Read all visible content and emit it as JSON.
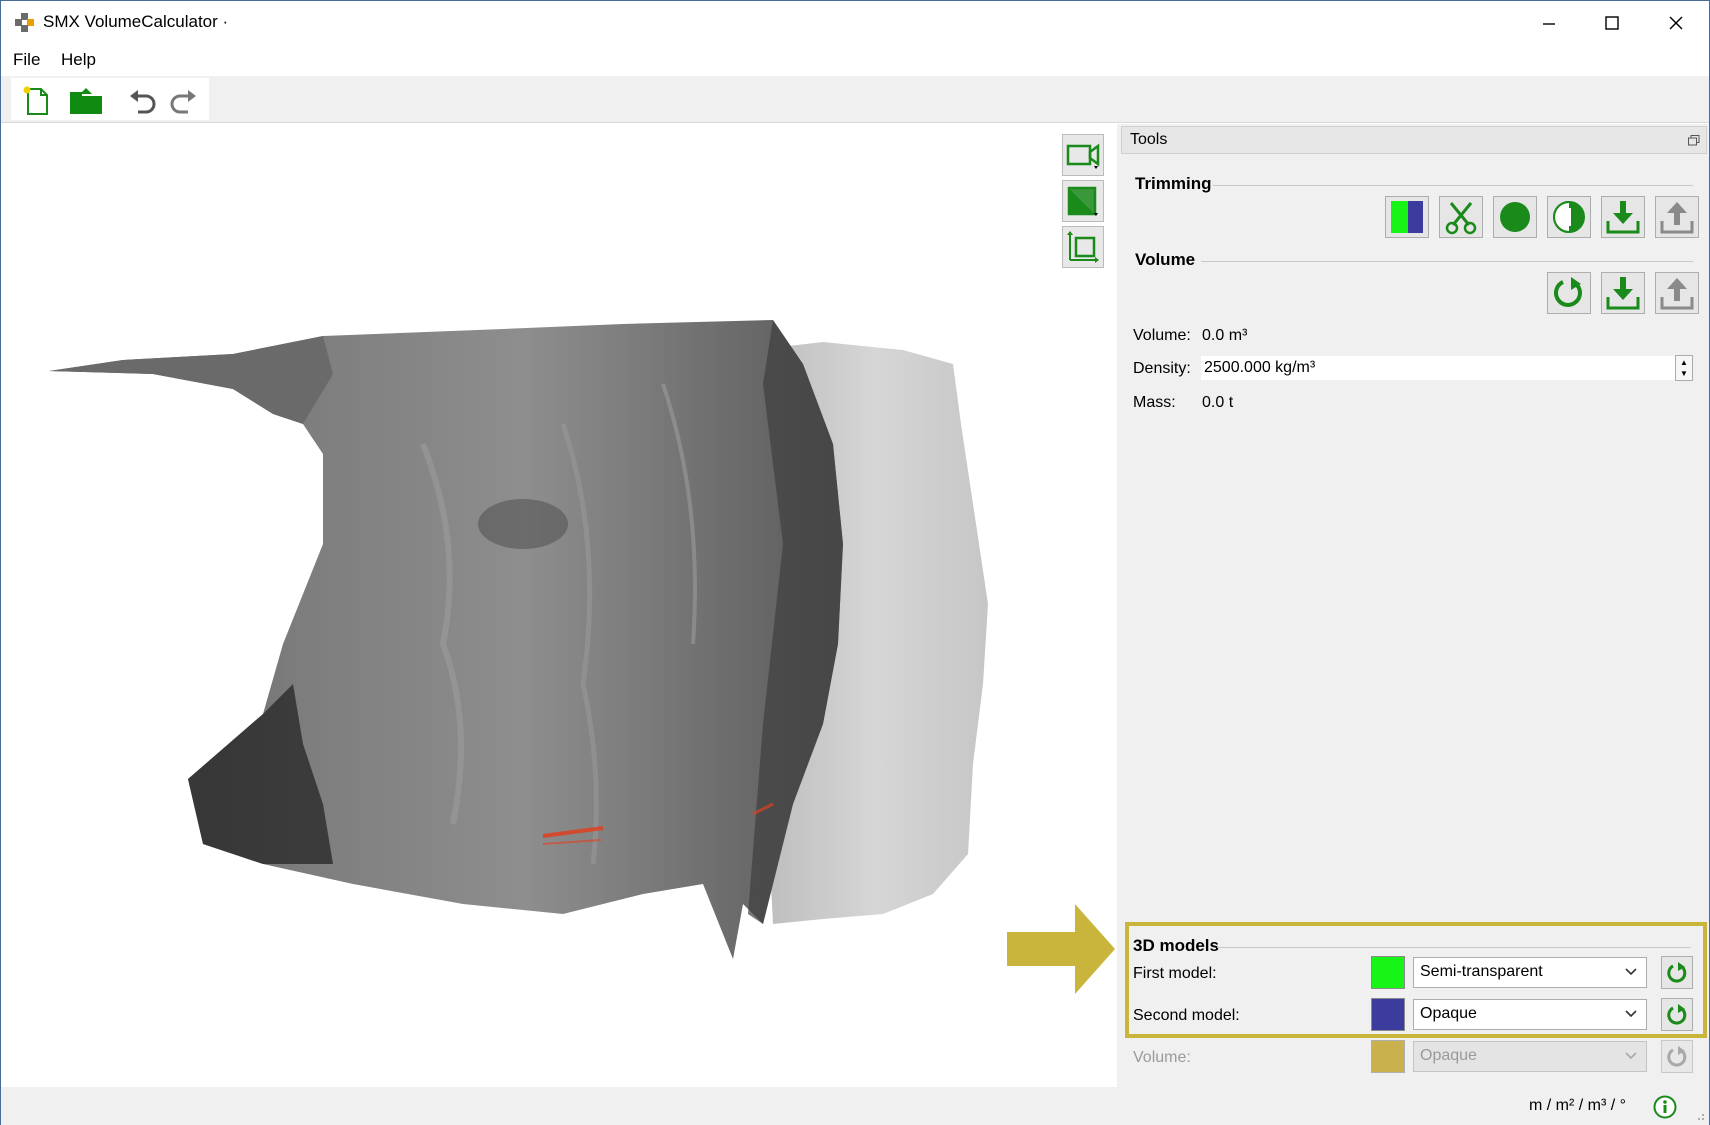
{
  "window": {
    "title": "SMX VolumeCalculator ·"
  },
  "menu": {
    "items": [
      "File",
      "Help"
    ]
  },
  "toolbar": {
    "buttons": [
      "new-document-icon",
      "open-folder-icon",
      "undo-icon",
      "redo-icon"
    ]
  },
  "viewport": {
    "buttons": [
      "camera-icon",
      "view-mode-icon",
      "bounding-box-icon"
    ]
  },
  "tools": {
    "title": "Tools",
    "trimming": {
      "title": "Trimming",
      "buttons": [
        "split-color-icon",
        "scissors-icon",
        "circle-icon",
        "half-circle-icon",
        "download-icon",
        "upload-icon"
      ]
    },
    "volume": {
      "title": "Volume",
      "buttons": [
        "refresh-icon",
        "download-icon",
        "upload-icon"
      ],
      "volume_label": "Volume:",
      "volume_value": "0.0 m³",
      "density_label": "Density:",
      "density_value": "2500.000 kg/m³",
      "mass_label": "Mass:",
      "mass_value": "0.0 t"
    },
    "models": {
      "title": "3D models",
      "first_label": "First model:",
      "first_color": "#16f516",
      "first_mode": "Semi-transparent",
      "second_label": "Second model:",
      "second_color": "#3c3c9e",
      "second_mode": "Opaque",
      "volume_label": "Volume:",
      "volume_color": "#c9b24e",
      "volume_mode": "Opaque"
    }
  },
  "status": {
    "units": "m / m² / m³ / °"
  },
  "colors": {
    "accent_green": "#1a8a1a",
    "highlight": "#c9b53b"
  }
}
